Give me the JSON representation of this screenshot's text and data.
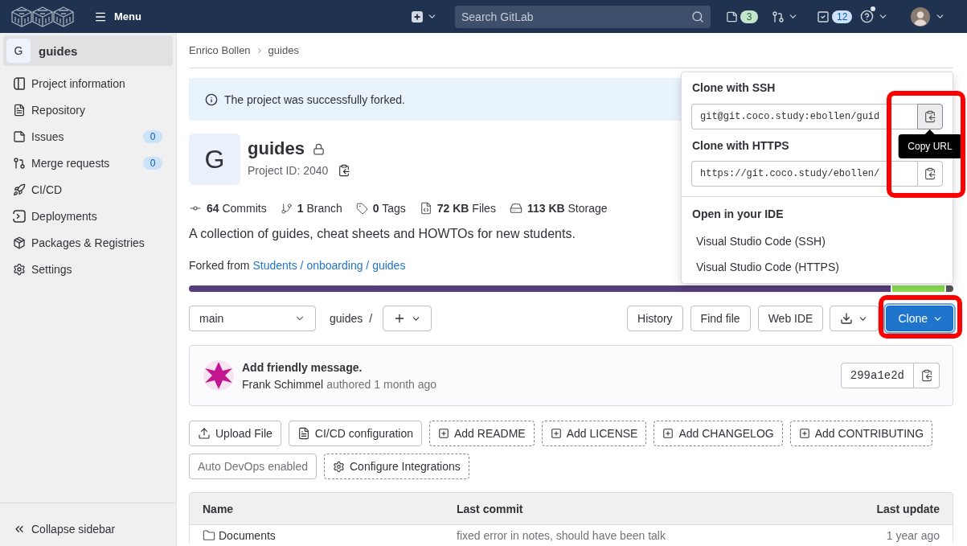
{
  "top_bar": {
    "menu_label": "Menu",
    "search": {
      "placeholder": "Search GitLab"
    },
    "issues_badge": "3",
    "todos_badge": "12",
    "help_notification": true
  },
  "sidebar": {
    "project": {
      "avatar_letter": "G",
      "name": "guides",
      "selected": true
    },
    "items": [
      {
        "label": "Project information"
      },
      {
        "label": "Repository"
      },
      {
        "label": "Issues",
        "count": "0"
      },
      {
        "label": "Merge requests",
        "count": "0"
      },
      {
        "label": "CI/CD"
      },
      {
        "label": "Deployments"
      },
      {
        "label": "Packages & Registries"
      },
      {
        "label": "Settings"
      }
    ],
    "collapse_label": "Collapse sidebar"
  },
  "breadcrumb": [
    "Enrico Bollen",
    "guides"
  ],
  "alert": {
    "message": "The project was successfully forked."
  },
  "project": {
    "avatar_letter": "G",
    "name": "guides",
    "private": true,
    "id_label": "Project ID: 2040",
    "stats": [
      {
        "value": "64",
        "label": "Commits"
      },
      {
        "value": "1",
        "label": "Branch"
      },
      {
        "value": "0",
        "label": "Tags"
      },
      {
        "value": "72 KB",
        "label": "Files"
      },
      {
        "value": "113 KB",
        "label": "Storage"
      }
    ],
    "description": "A collection of guides, cheat sheets and HOWTOs for new students.",
    "forked_from": {
      "prefix": "Forked from",
      "link": "Students / onboarding / guides"
    }
  },
  "repo_bar": {
    "branch": "main",
    "path": "guides",
    "separator": "/",
    "buttons": [
      "History",
      "Find file",
      "Web IDE"
    ],
    "clone_button": {
      "label": "Clone",
      "expanded": true,
      "highlighted": true
    }
  },
  "clone_dropdown": {
    "copy_buttons_highlighted": true,
    "options": [
      {
        "heading": "Clone with SSH",
        "url": "git@git.coco.study:ebollen/guid",
        "copy_hovered": true,
        "tooltip": "Copy URL"
      },
      {
        "heading": "Clone with HTTPS",
        "url": "https://git.coco.study/ebollen/",
        "copy_hovered": false
      }
    ],
    "ide": {
      "heading": "Open in your IDE",
      "items": [
        "Visual Studio Code (SSH)",
        "Visual Studio Code (HTTPS)"
      ]
    }
  },
  "last_commit": {
    "title": "Add friendly message.",
    "author": "Frank Schimmel",
    "meta": "authored 1 month ago",
    "sha": "299a1e2d"
  },
  "action_rows": [
    [
      {
        "label": "Upload File",
        "kind": "upload"
      },
      {
        "label": "CI/CD configuration",
        "kind": "config"
      },
      {
        "label": "Add README",
        "kind": "add"
      },
      {
        "label": "Add LICENSE",
        "kind": "add"
      },
      {
        "label": "Add CHANGELOG",
        "kind": "add"
      },
      {
        "label": "Add CONTRIBUTING",
        "kind": "add"
      }
    ],
    [
      {
        "label": "Auto DevOps enabled",
        "kind": "status"
      },
      {
        "label": "Configure Integrations",
        "kind": "integrations"
      }
    ]
  ],
  "file_table": {
    "columns": [
      "Name",
      "Last commit",
      "Last update"
    ],
    "rows": [
      {
        "kind": "folder",
        "name": "Documents",
        "last_commit": "fixed error in notes, should have been talk",
        "last_update": "1 year ago"
      }
    ]
  }
}
